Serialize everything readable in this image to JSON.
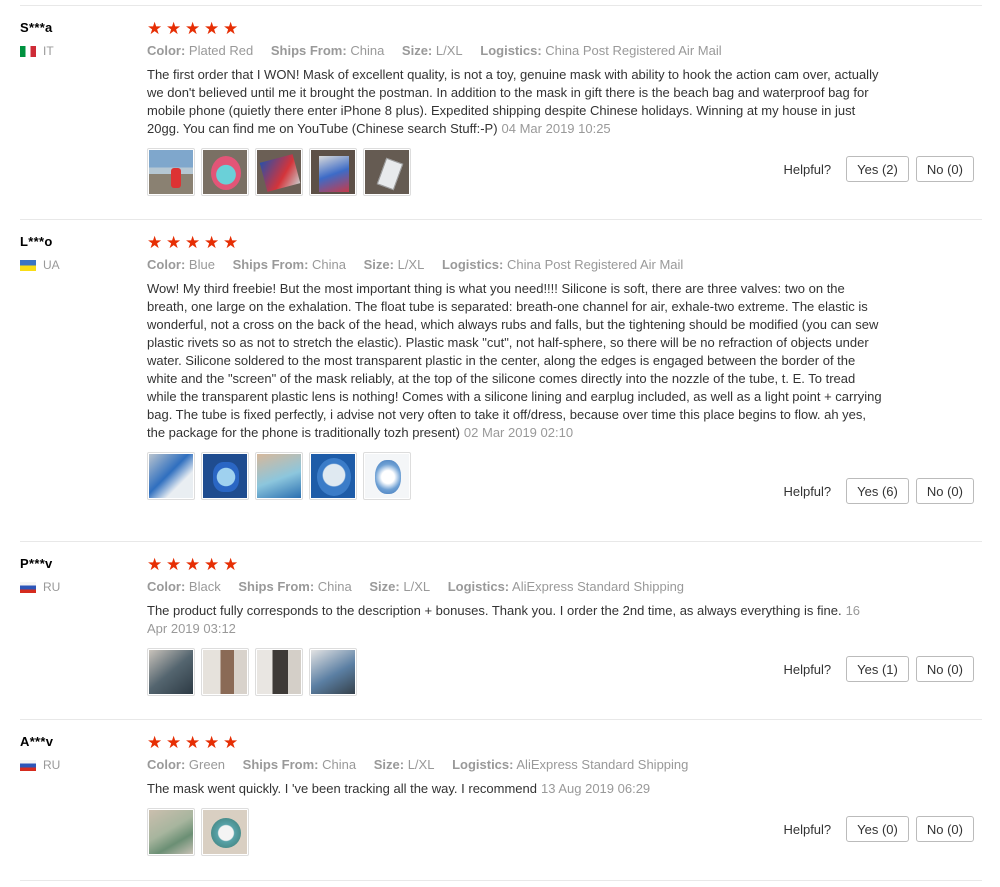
{
  "labels": {
    "color": "Color:",
    "ships_from": "Ships From:",
    "size": "Size:",
    "logistics": "Logistics:",
    "helpful": "Helpful?"
  },
  "stars_glyph": "★",
  "reviews": [
    {
      "user": "S***a",
      "country": "IT",
      "rating": 5,
      "color": "Plated Red",
      "ships_from": "China",
      "size": "L/XL",
      "logistics": "China Post Registered Air Mail",
      "text": "The first order that I WON! Mask of excellent quality, is not a toy, genuine mask with ability to hook the action cam over, actually we don't believed until me it brought the postman. In addition to the mask in gift there is the beach bag and waterproof bag for mobile phone (quietly there enter iPhone 8 plus). Expedited shipping despite Chinese holidays. Winning at my house in just 20gg. You can find me on YouTube (Chinese search Stuff:-P)",
      "date": "04 Mar 2019 10:25",
      "photo_count": 5,
      "yes": "Yes (2)",
      "no": "No (0)"
    },
    {
      "user": "L***o",
      "country": "UA",
      "rating": 5,
      "color": "Blue",
      "ships_from": "China",
      "size": "L/XL",
      "logistics": "China Post Registered Air Mail",
      "text": "Wow! My third freebie! But the most important thing is what you need!!!! Silicone is soft, there are three valves: two on the breath, one large on the exhalation. The float tube is separated: breath-one channel for air, exhale-two extreme. The elastic is wonderful, not a cross on the back of the head, which always rubs and falls, but the tightening should be modified (you can sew plastic rivets so as not to stretch the elastic). Plastic mask \"cut\", not half-sphere, so there will be no refraction of objects under water. Silicone soldered to the most transparent plastic in the center, along the edges is engaged between the border of the white and the \"screen\" of the mask reliably, at the top of the silicone comes directly into the nozzle of the tube, t. E. To tread while the transparent plastic lens is nothing! Comes with a silicone lining and earplug included, as well as a light point + carrying bag. The tube is fixed perfectly, i advise not very often to take it off/dress, because over time this place begins to flow. ah yes, the package for the phone is traditionally tozh present)",
      "date": "02 Mar 2019 02:10",
      "photo_count": 5,
      "yes": "Yes (6)",
      "no": "No (0)"
    },
    {
      "user": "P***v",
      "country": "RU",
      "rating": 5,
      "color": "Black",
      "ships_from": "China",
      "size": "L/XL",
      "logistics": "AliExpress Standard Shipping",
      "text": "The product fully corresponds to the description + bonuses. Thank you. I order the 2nd time, as always everything is fine.",
      "date": "16 Apr 2019 03:12",
      "photo_count": 4,
      "yes": "Yes (1)",
      "no": "No (0)"
    },
    {
      "user": "A***v",
      "country": "RU",
      "rating": 5,
      "color": "Green",
      "ships_from": "China",
      "size": "L/XL",
      "logistics": "AliExpress Standard Shipping",
      "text": "The mask went quickly. I 've been tracking all the way. I recommend",
      "date": "13 Aug 2019 06:29",
      "photo_count": 2,
      "yes": "Yes (0)",
      "no": "No (0)"
    }
  ]
}
